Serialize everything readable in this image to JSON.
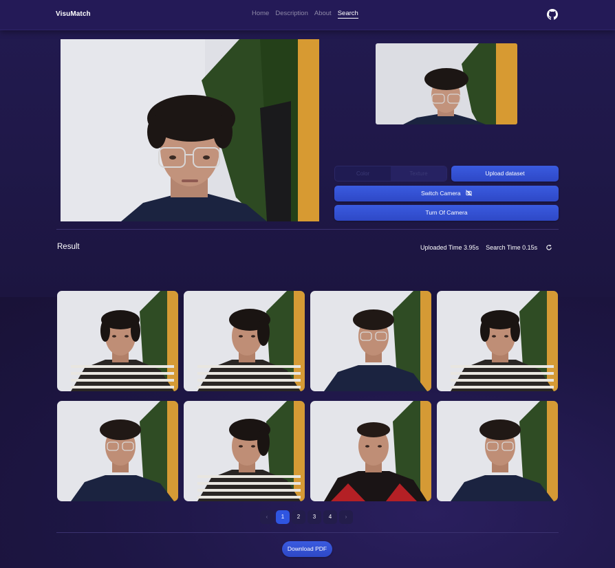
{
  "app": {
    "brand": "VisuMatch"
  },
  "nav": {
    "links": [
      {
        "label": "Home",
        "active": false
      },
      {
        "label": "Description",
        "active": false
      },
      {
        "label": "About",
        "active": false
      },
      {
        "label": "Search",
        "active": true
      }
    ],
    "github_icon": "github-icon"
  },
  "camera": {
    "main_feed": "live-camera-feed",
    "preview": "captured-frame-preview"
  },
  "controls": {
    "mode_options": [
      "Color",
      "Texture"
    ],
    "selected_mode": "Texture",
    "upload_label": "Upload dataset",
    "switch_camera_label": "Switch Camera",
    "switch_camera_icon": "camera-off-icon",
    "turn_off_label": "Turn Of Camera"
  },
  "result": {
    "title": "Result",
    "uploaded_time": "Uploaded Time 3.95s",
    "search_time": "Search Time 0.15s",
    "refresh_icon": "refresh-icon",
    "items": [
      {
        "shirt": "striped",
        "hair": "long"
      },
      {
        "shirt": "striped",
        "hair": "long-side"
      },
      {
        "shirt": "navy",
        "hair": "curly",
        "glasses": true
      },
      {
        "shirt": "striped",
        "hair": "long"
      },
      {
        "shirt": "navy",
        "hair": "curly",
        "glasses": true
      },
      {
        "shirt": "striped",
        "hair": "long-side"
      },
      {
        "shirt": "red-black",
        "hair": "short"
      },
      {
        "shirt": "navy",
        "hair": "curly",
        "glasses": true
      }
    ]
  },
  "pagination": {
    "prev": "‹",
    "next": "›",
    "pages": [
      "1",
      "2",
      "3",
      "4"
    ],
    "current": "1"
  },
  "download": {
    "label": "Download PDF"
  },
  "colors": {
    "accent": "#2f55e0",
    "background": "#1c1640",
    "navbar": "#241a57"
  }
}
